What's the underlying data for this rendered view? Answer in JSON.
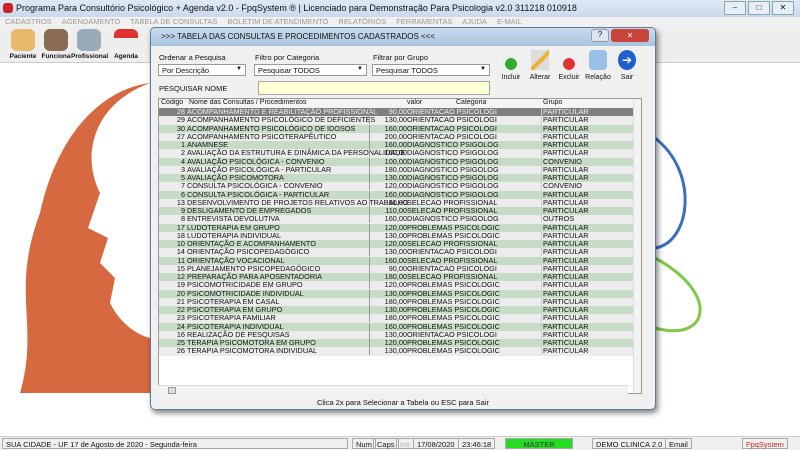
{
  "window": {
    "title": "Programa Para Consultório Psicológico + Agenda v2.0 - FpqSystem ® | Licenciado para  Demonstração Para Psicologia v2.0 311218 010918"
  },
  "menu": [
    "CADASTROS",
    "AGENDAMENTO",
    "TABELA DE CONSULTAS",
    "BOLETIM DE ATENDIMENTO",
    "RELATÓRIOS",
    "FERRAMENTAS",
    "AJUDA",
    "E-MAIL"
  ],
  "toolbar": [
    {
      "label": "Paciente",
      "icon": "patient-icon"
    },
    {
      "label": "Funciona",
      "icon": "employee-icon"
    },
    {
      "label": "Profissional",
      "icon": "doctor-icon"
    },
    {
      "label": "Agenda",
      "icon": "calendar-icon"
    }
  ],
  "dialog": {
    "title": ">>>  TABELA DAS CONSULTAS E PROCEDIMENTOS CADASTRADOS  <<<",
    "order_label": "Ordenar a Pesquisa",
    "order_value": "Por Descrição",
    "category_label": "Filtro por Categoria",
    "category_value": "Pesquisar TODOS",
    "group_label": "Filtrar por Grupo",
    "group_value": "Pesquisar TODOS",
    "search_label": "PESQUISAR NOME",
    "search_value": "",
    "actions": [
      "Incluir",
      "Alterar",
      "Excluir",
      "Relação",
      "Sair"
    ],
    "columns": [
      "Código",
      "Nome das Consultas / Procedimentos",
      "valor",
      "Categoria",
      "Grupo"
    ],
    "rows": [
      [
        "28",
        "ACOMPANHAMENTO E REABILITAÇÃO PROFISSIONAL",
        "90,00",
        "ORIENTACAO PSICOLOGI",
        "PARTICULAR"
      ],
      [
        "29",
        "ACOMPANHAMENTO PSICOLÓGICO DE DEFICIENTES",
        "130,00",
        "ORIENTACAO PSICOLOGI",
        "PARTICULAR"
      ],
      [
        "30",
        "ACOMPANHAMENTO PSICOLÓGICO DE IDOSOS",
        "160,00",
        "ORIENTACAO PSICOLOGI",
        "PARTICULAR"
      ],
      [
        "27",
        "ACOMPANHAMENTO PSICOTERAPÊUTICO",
        "200,00",
        "ORIENTACAO PSICOLOGI",
        "PARTICULAR"
      ],
      [
        "1",
        "ANAMNESE",
        "160,00",
        "DIAGNOSTICO PSIGOLOG",
        "PARTICULAR"
      ],
      [
        "2",
        "AVALIAÇÃO DA ESTRUTURA E DINÂMICA DA PERSONALIDADE",
        "160,00",
        "DIAGNOSTICO PSIGOLOG",
        "PARTICULAR"
      ],
      [
        "4",
        "AVALIAÇÃO PSICOLÓGICA - CONVENIO",
        "100,00",
        "DIAGNOSTICO PSIGOLOG",
        "CONVENIO"
      ],
      [
        "3",
        "AVALIAÇÃO PSICOLÓGICA - PARTICULAR",
        "180,00",
        "DIAGNOSTICO PSIGOLOG",
        "PARTICULAR"
      ],
      [
        "5",
        "AVALIAÇÃO PSICOMOTORA",
        "130,00",
        "DIAGNOSTICO PSIGOLOG",
        "PARTICULAR"
      ],
      [
        "7",
        "CONSULTA PSICOLÓGICA - CONVENIO",
        "120,00",
        "DIAGNOSTICO PSIGOLOG",
        "CONVENIO"
      ],
      [
        "6",
        "CONSULTA PSICOLÓGICA - PARTICULAR",
        "160,00",
        "DIAGNOSTICO PSIGOLOG",
        "PARTICULAR"
      ],
      [
        "13",
        "DESENVOLVIMENTO DE PROJETOS RELATIVOS AO TRABALHO",
        "90,00",
        "SELECAO PROFISSIONAL",
        "PARTICULAR"
      ],
      [
        "9",
        "DESLIGAMENTO DE EMPREGADOS",
        "110,00",
        "SELECAO PROFISSIONAL",
        "PARTICULAR"
      ],
      [
        "8",
        "ENTREVISTA DEVOLUTIVA",
        "160,00",
        "DIAGNOSTICO PSIGOLOG",
        "OUTROS"
      ],
      [
        "17",
        "LUDOTERAPIA EM GRUPO",
        "120,00",
        "PROBLEMAS PSICOLOGIC",
        "PARTICULAR"
      ],
      [
        "18",
        "LUDOTERAPIA INDIVIDUAL",
        "130,00",
        "PROBLEMAS PSICOLOGIC",
        "PARTICULAR"
      ],
      [
        "10",
        "ORIENTAÇÃO E ACOMPANHAMENTO",
        "120,00",
        "SELECAO PROFISSIONAL",
        "PARTICULAR"
      ],
      [
        "14",
        "ORIENTAÇÃO PSICOPEDAGÓGICO",
        "130,00",
        "ORIENTACAO PSICOLOGI",
        "PARTICULAR"
      ],
      [
        "11",
        "ORIENTAÇÃO VOCACIONAL",
        "160,00",
        "SELECAO PROFISSIONAL",
        "PARTICULAR"
      ],
      [
        "15",
        "PLANEJAMENTO PSICOPEDAGÓGICO",
        "90,00",
        "ORIENTACAO PSICOLOGI",
        "PARTICULAR"
      ],
      [
        "12",
        "PREPARAÇÃO PARA APOSENTADORIA",
        "180,00",
        "SELECAO PROFISSIONAL",
        "PARTICULAR"
      ],
      [
        "19",
        "PSICOMOTRICIDADE EM GRUPO",
        "120,00",
        "PROBLEMAS PSICOLOGIC",
        "PARTICULAR"
      ],
      [
        "20",
        "PSICOMOTRICIDADE INDIVIDUAL",
        "130,00",
        "PROBLEMAS PSICOLOGIC",
        "PARTICULAR"
      ],
      [
        "21",
        "PSICOTERAPIA EM CASAL",
        "180,00",
        "PROBLEMAS PSICOLOGIC",
        "PARTICULAR"
      ],
      [
        "22",
        "PSICOTERAPIA EM GRUPO",
        "130,00",
        "PROBLEMAS PSICOLOGIC",
        "PARTICULAR"
      ],
      [
        "23",
        "PSICOTERAPIA FAMILIAR",
        "180,00",
        "PROBLEMAS PSICOLOGIC",
        "PARTICULAR"
      ],
      [
        "24",
        "PSICOTERAPIA INDIVIDUAL",
        "160,00",
        "PROBLEMAS PSICOLOGIC",
        "PARTICULAR"
      ],
      [
        "16",
        "REALIZAÇÃO DE PESQUISAS",
        "130,00",
        "ORIENTACAO PSICOLOGI",
        "PARTICULAR"
      ],
      [
        "25",
        "TERAPIA PSICOMOTORA EM GRUPO",
        "120,00",
        "PROBLEMAS PSICOLOGIC",
        "PARTICULAR"
      ],
      [
        "26",
        "TERAPIA PSICOMOTORA INDIVIDUAL",
        "130,00",
        "PROBLEMAS PSICOLOGIC",
        "PARTICULAR"
      ]
    ],
    "hint": "Clica 2x para Selecionar a Tabela ou ESC para Sair"
  },
  "status": {
    "location": "SUA CIDADE - UF 17 de Agosto de 2020 - Segunda-feira",
    "num": "Num",
    "caps": "Caps",
    "ins": "Ins",
    "date": "17/08/2020",
    "time": "23:46:18",
    "user": "MASTER",
    "clinic": "DEMO CLINICA 2.0",
    "email": "Email",
    "brand": "FpqSystem"
  },
  "colors": {
    "row_green": "#c7dcc6",
    "row_light": "#ececec",
    "selected": "#7f7f7f",
    "user_badge": "#22dd22",
    "search_bg": "#ffffd6"
  }
}
